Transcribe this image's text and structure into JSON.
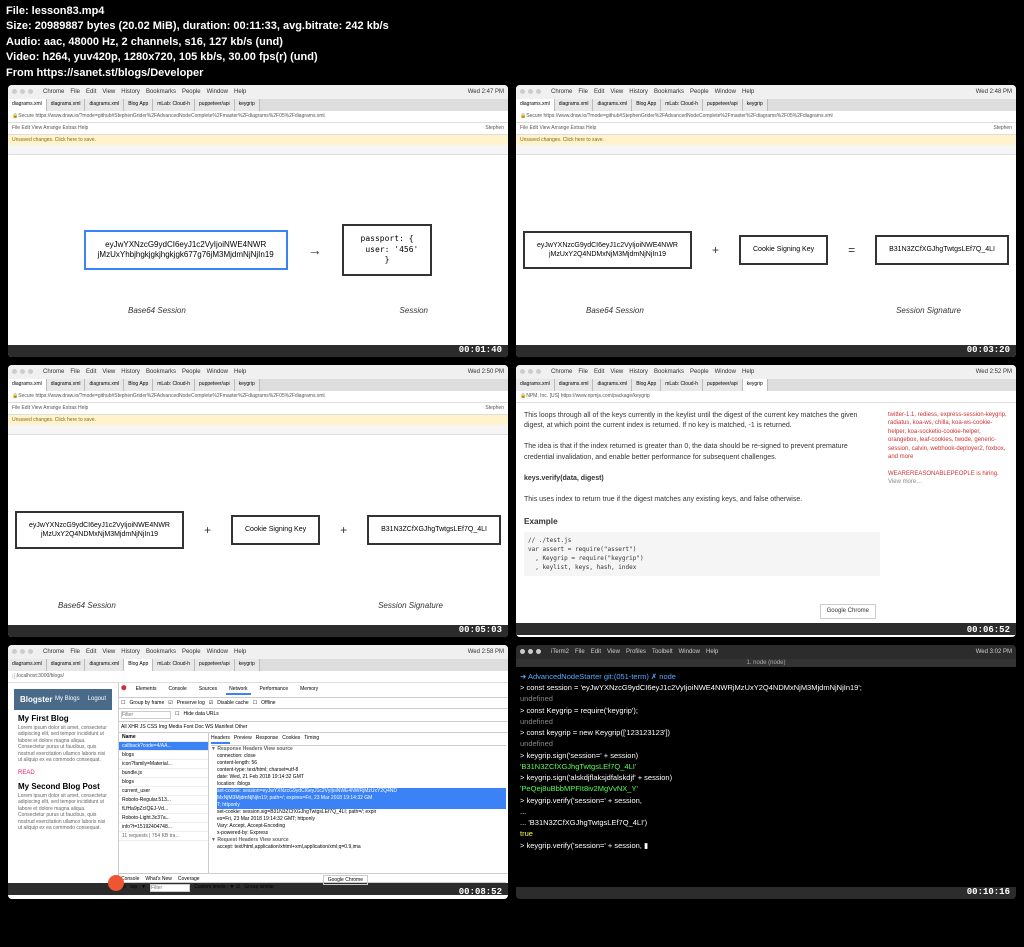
{
  "header": {
    "file": "File: lesson83.mp4",
    "size": "Size: 20989887 bytes (20.02 MiB), duration: 00:11:33, avg.bitrate: 242 kb/s",
    "audio": "Audio: aac, 48000 Hz, 2 channels, s16, 127 kb/s (und)",
    "video": "Video: h264, yuv420p, 1280x720, 105 kb/s, 30.00 fps(r) (und)",
    "from": "From https://sanet.st/blogs/Developer"
  },
  "menu": {
    "chrome": "Chrome",
    "file": "File",
    "edit": "Edit",
    "view": "View",
    "history": "History",
    "bookmarks": "Bookmarks",
    "people": "People",
    "window": "Window",
    "help": "Help",
    "iterm": "iTerm2",
    "profiles": "Profiles",
    "toolbelt": "Toolbelt"
  },
  "chrome": {
    "secure": "Secure",
    "url": "https://www.draw.io/?mode=github#StephenGrider%2FAdvancedNodeComplete%2Fmaster%2Fdiagrams%2F05%2Fdiagrams.xml",
    "tabs": [
      "diagrams.xml",
      "diagrams.xml",
      "diagrams.xml",
      "Blog App",
      "mLab: Cloud-h",
      "puppeteer/api",
      "keygrip"
    ],
    "editbar": "File  Edit  View  Arrange  Extras  Help",
    "warning": "Unsaved changes. Click here to save.",
    "user": "Stephen"
  },
  "panel1": {
    "box1": "eyJwYXNzcG9ydCI6eyJ1c2VyIjoiNWE4NWR\njMzUxYhbjhgkjgkjhgkjgk677g76jM3MjdmNjNjIn19",
    "box2": "passport: {\n  user: '456'\n}",
    "label1": "Base64 Session",
    "label2": "Session",
    "time": "Wed 2:47 PM",
    "ts": "00:01:40"
  },
  "panel2": {
    "box1": "eyJwYXNzcG9ydCI6eyJ1c2VyIjoiNWE4NWR\njMzUxY2Q4NDMxNjM3MjdmNjNjIn19",
    "box2": "Cookie Signing Key",
    "box3": "B31N3ZCfXGJhgTwtgsLEf7Q_4LI",
    "label1": "Base64 Session",
    "label2": "Session Signature",
    "time": "Wed 2:48 PM",
    "ts": "00:03:20"
  },
  "panel3": {
    "box1": "eyJwYXNzcG9ydCI6eyJ1c2VyIjoiNWE4NWR\njMzUxY2Q4NDMxNjM3MjdmNjNjIn19",
    "box2": "Cookie Signing Key",
    "box3": "B31N3ZCfXGJhgTwtgsLEf7Q_4LI",
    "label1": "Base64 Session",
    "label2": "Session Signature",
    "time": "Wed 2:50 PM",
    "ts": "00:05:03"
  },
  "panel4": {
    "url": "https://www.npmjs.com/package/keygrip",
    "npm": "NPM, Inc. [US]",
    "p1": "This loops through all of the keys currently in the keylist until the digest of the current key matches the given digest, at which point the current index is returned. If no key is matched, -1 is returned.",
    "p2": "The idea is that if the index returned is greater than 0, the data should be re-signed to prevent premature credential invalidation, and enable better performance for subsequent challenges.",
    "h1": "keys.verify(data, digest)",
    "p3": "This uses index to return true if the digest matches any existing keys, and false otherwise.",
    "h2": "Example",
    "code": "// ./test.js\nvar assert = require(\"assert\")\n  , Keygrip = require(\"keygrip\")\n  , keylist, keys, hash, index",
    "sidebar": "twitter-1.1, rediess, express-session-keygrip, radiatus, koa-ws, chilla, koa-ws-cookie-helper, koa-socketio-cookie-helper, orangebox, leaf-cookies, twode, generic-session, calvin, webhook-deployer2, foxbox, and more",
    "hiring": "WEAREREASONABLEPEOPLE is hiring.",
    "viewmore": "View more…",
    "googlechrome": "Google Chrome",
    "time": "Wed 2:52 PM",
    "ts": "00:06:52"
  },
  "panel5": {
    "url": "localhost:3000/blogs/",
    "time": "Wed 2:58 PM",
    "ts": "00:08:52",
    "app": "Blogster",
    "nav1": "My Blogs",
    "nav2": "Logout",
    "blog1": "My First Blog",
    "blog2": "My Second Blog Post",
    "lorem": "Lorem ipsum dolor sit amet, consectetur adipiscing elit, sed tempor incididunt ut labore et dolore magna aliqua. Consectetur purus ut faucibus, quis nostrud exercitation ullamco laboris nisi ut aliquip ex ea commodo consequat.",
    "read": "READ",
    "dt": {
      "elements": "Elements",
      "console": "Console",
      "sources": "Sources",
      "network": "Network",
      "performance": "Performance",
      "memory": "Memory",
      "filter": "Filter",
      "hideurls": "Hide data URLs",
      "preservelog": "Preserve log",
      "disablecache": "Disable cache",
      "offline": "Offline",
      "groupby": "Group by frame",
      "types": "All  XHR  JS  CSS  Img  Media  Font  Doc  WS  Manifest  Other",
      "name": "Name",
      "headers": "Headers",
      "preview": "Preview",
      "response": "Response",
      "cookies": "Cookies",
      "timing": "Timing",
      "items": [
        "callback?code=4/AA...",
        "blogs",
        "icon?family=Material...",
        "bundle.js",
        "blogs",
        "current_user",
        "Roboto-Regular.513...",
        "fLfHa9pZcIQEJ-Vd...",
        "Roboto-Light.3c37a...",
        "info?t=15192404748..."
      ],
      "reqcount": "11 requests | 754 KB tra...",
      "rh": "▼ Response Headers    View source",
      "h": {
        "conn": "connection: close",
        "cl": "content-length: 56",
        "ct": "content-type: text/html; charset=utf-8",
        "date": "date: Wed, 21 Feb 2018 19:14:32 GMT",
        "loc": "location: /blogs",
        "sc1": "set-cookie: session=eyJwYXNzcG9ydCI6eyJ1c2VyIjoiNWE4NWRjMzUxY2Q4ND\nMxNjM3MjdmNjNjIn19; path=/; expires=Fri, 23 Mar 2018 19:14:32 GM\nT; httponly",
        "sc2": "set-cookie: session.sig=B31N3ZCfXGJhgTwtgsLEf7Q_4LI; path=/; expir\nes=Fri, 23 Mar 2018 19:14:32 GMT; httponly",
        "vary": "Vary: Accept, Accept-Encoding",
        "xpb": "x-powered-by: Express"
      },
      "reqh": "▼ Request Headers    View source",
      "accept": "accept: text/html,application/xhtml+xml,application/xml;q=0.9,ima",
      "consoletab": "Console",
      "whatsnew": "What's New",
      "coverage": "Coverage",
      "top": "top",
      "filter2": "Filter",
      "levels": "Custom levels",
      "groupsim": "Group similar",
      "googlechrome": "Google Chrome"
    }
  },
  "panel6": {
    "time": "Wed 3:02 PM",
    "ts": "00:10:16",
    "title": "1. node (node)",
    "lines": [
      {
        "c": "prompt",
        "t": "➜  AdvancedNodeStarter git:(051-term) ✗ node"
      },
      {
        "c": "white",
        "t": "> const session = 'eyJwYXNzcG9ydCI6eyJ1c2VyIjoiNWE4NWRjMzUxY2Q4NDMxNjM3MjdmNjNjIn19';"
      },
      {
        "c": "gray",
        "t": "undefined"
      },
      {
        "c": "white",
        "t": "> const Keygrip = require('keygrip');"
      },
      {
        "c": "gray",
        "t": "undefined"
      },
      {
        "c": "white",
        "t": "> const keygrip = new Keygrip(['123123123'])"
      },
      {
        "c": "gray",
        "t": "undefined"
      },
      {
        "c": "white",
        "t": "> keygrip.sign('session=' + session)"
      },
      {
        "c": "green",
        "t": "'B31N3ZCfXGJhgTwtgsLEf7Q_4LI'"
      },
      {
        "c": "white",
        "t": "> keygrip.sign('alskdjflaksjdfalskdjf' + session)"
      },
      {
        "c": "green",
        "t": "'PeQej8uBbbMPFIt8iv2MgVvNX_Y'"
      },
      {
        "c": "white",
        "t": "> keygrip.verify('session=' + session,"
      },
      {
        "c": "white",
        "t": "..."
      },
      {
        "c": "white",
        "t": "... 'B31N3ZCfXGJhgTwtgsLEf7Q_4LI')"
      },
      {
        "c": "yellow",
        "t": "true"
      },
      {
        "c": "white",
        "t": "> keygrip.verify('session=' + session, ▮"
      }
    ]
  }
}
